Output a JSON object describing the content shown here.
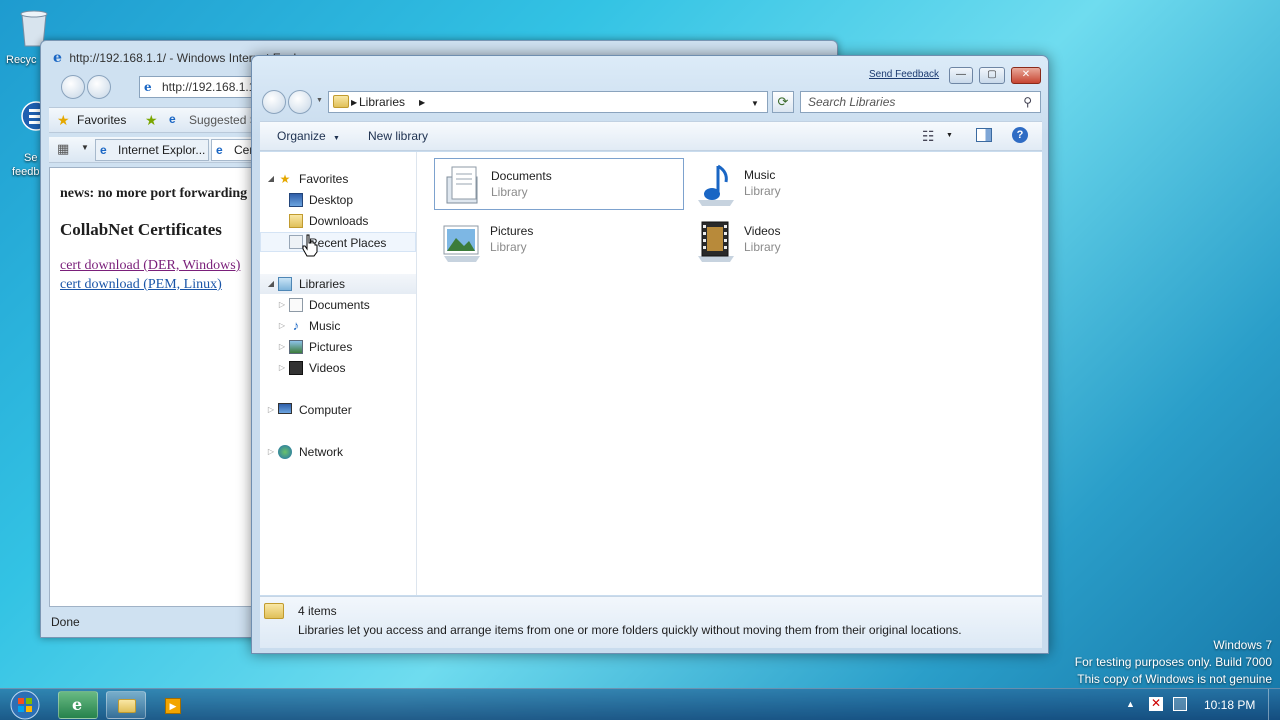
{
  "desktop": {
    "recycle_label": "Recyc",
    "feedback_label_1": "Se",
    "feedback_label_2": "feedb",
    "watermark": {
      "line1": "Windows  7",
      "line2": "For testing purposes only. Build 7000",
      "line3": "This copy of Windows is not genuine"
    }
  },
  "ie": {
    "title": "http://192.168.1.1/ - Windows Internet Explorer",
    "address": "http://192.168.1.1/",
    "favorites_label": "Favorites",
    "suggested_label": "Suggested Sites",
    "tab1": "Internet Explor...",
    "tab2": "Certificates",
    "content": {
      "news": "news: no more port forwarding",
      "heading": "CollabNet Certificates",
      "link1": "cert download (DER, Windows)",
      "link2": "cert download (PEM, Linux)"
    },
    "status": "Done"
  },
  "explorer": {
    "send_feedback": "Send Feedback",
    "breadcrumb": "Libraries",
    "search_placeholder": "Search Libraries",
    "organize": "Organize",
    "new_library": "New library",
    "nav": {
      "favorites": "Favorites",
      "desktop": "Desktop",
      "downloads": "Downloads",
      "recent_places": "Recent Places",
      "libraries": "Libraries",
      "documents": "Documents",
      "music": "Music",
      "pictures": "Pictures",
      "videos": "Videos",
      "computer": "Computer",
      "network": "Network"
    },
    "libraries": [
      {
        "name": "Documents",
        "type": "Library"
      },
      {
        "name": "Music",
        "type": "Library"
      },
      {
        "name": "Pictures",
        "type": "Library"
      },
      {
        "name": "Videos",
        "type": "Library"
      }
    ],
    "details": {
      "count": "4 items",
      "description": "Libraries let you access and arrange items from one or more folders quickly without moving them from their original locations."
    }
  },
  "taskbar": {
    "clock": "10:18 PM"
  },
  "colors": {
    "accent": "#1b3a70",
    "link_visited": "#7a1f7a",
    "link": "#1a55a8"
  }
}
